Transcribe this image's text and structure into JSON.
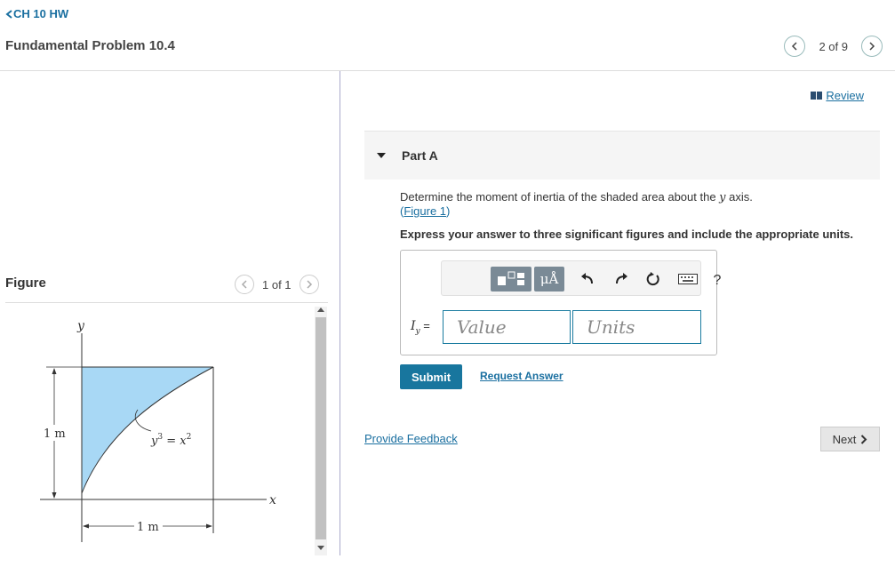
{
  "header": {
    "back_label": "CH 10 HW",
    "title": "Fundamental Problem 10.4",
    "pager_text": "2 of 9"
  },
  "figure_panel": {
    "heading": "Figure",
    "pager_text": "1 of 1",
    "labels": {
      "y_axis": "y",
      "x_axis": "x",
      "height_dim": "1 m",
      "width_dim": "1 m",
      "curve_eq_base": "y",
      "curve_eq_exp1": "3",
      "curve_eq_mid": " = x",
      "curve_eq_exp2": "2"
    },
    "shade_color": "#a8d8f5"
  },
  "review_label": "Review",
  "part": {
    "label": "Part A",
    "question_prefix": "Determine the moment of inertia of the shaded area about the ",
    "question_var": "y",
    "question_suffix": " axis.",
    "figure_link_open": "(",
    "figure_link": "Figure 1",
    "figure_link_close": ")",
    "instructions": "Express your answer to three significant figures and include the appropriate units."
  },
  "answer": {
    "label_var": "I",
    "label_sub": "y",
    "label_eq": " =",
    "value_placeholder": "Value",
    "units_placeholder": "Units",
    "toolbar": {
      "mu_angstrom": "μÅ",
      "help": "?"
    }
  },
  "actions": {
    "submit": "Submit",
    "request_answer": "Request Answer",
    "provide_feedback": "Provide Feedback",
    "next": "Next"
  },
  "colors": {
    "link": "#1a6fa0",
    "submit_bg": "#18769e",
    "input_border": "#1a7ba0"
  }
}
